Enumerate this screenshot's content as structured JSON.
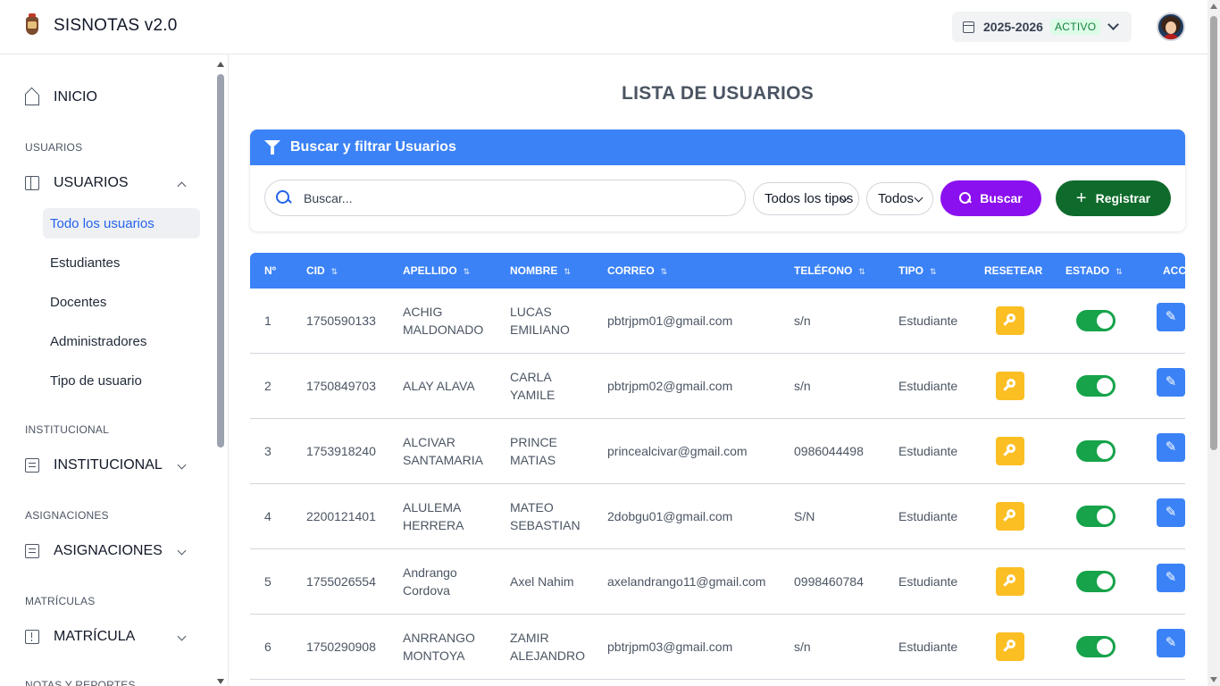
{
  "header": {
    "brand": "SISNOTAS v2.0",
    "period_year": "2025-2026",
    "period_status": "ACTIVO"
  },
  "sidebar": {
    "inicio": "INICIO",
    "sec_usuarios": "USUARIOS",
    "usuarios": "USUARIOS",
    "sub": [
      "Todo los usuarios",
      "Estudiantes",
      "Docentes",
      "Administradores",
      "Tipo de usuario"
    ],
    "sec_institucional": "INSTITUCIONAL",
    "institucional": "INSTITUCIONAL",
    "sec_asignaciones": "ASIGNACIONES",
    "asignaciones": "ASIGNACIONES",
    "sec_matriculas": "MATRÍCULAS",
    "matricula": "MATRÍCULA",
    "sec_notas": "NOTAS Y REPORTES"
  },
  "main": {
    "title": "LISTA DE USUARIOS",
    "filter_title": "Buscar y filtrar Usuarios",
    "search_placeholder": "Buscar...",
    "type_select": "Todos los tipos",
    "state_select": "Todos",
    "search_button": "Buscar",
    "register_button": "Registrar"
  },
  "table": {
    "columns": [
      "Nº",
      "CID",
      "APELLIDO",
      "NOMBRE",
      "CORREO",
      "TELÉFONO",
      "TIPO",
      "RESETEAR",
      "ESTADO",
      "ACCI"
    ],
    "sort_glyph": "⇅",
    "edit_glyph": "✎",
    "rows": [
      {
        "n": "1",
        "cid": "1750590133",
        "ap1": "ACHIG",
        "ap2": "MALDONADO",
        "no1": "LUCAS",
        "no2": "EMILIANO",
        "correo": "pbtrjpm01@gmail.com",
        "tel": "s/n",
        "tipo": "Estudiante"
      },
      {
        "n": "2",
        "cid": "1750849703",
        "ap1": "ALAY ALAVA",
        "ap2": "",
        "no1": "CARLA",
        "no2": "YAMILE",
        "correo": "pbtrjpm02@gmail.com",
        "tel": "s/n",
        "tipo": "Estudiante"
      },
      {
        "n": "3",
        "cid": "1753918240",
        "ap1": "ALCIVAR",
        "ap2": "SANTAMARIA",
        "no1": "PRINCE",
        "no2": "MATIAS",
        "correo": "princealcivar@gmail.com",
        "tel": "0986044498",
        "tipo": "Estudiante"
      },
      {
        "n": "4",
        "cid": "2200121401",
        "ap1": "ALULEMA",
        "ap2": "HERRERA",
        "no1": "MATEO",
        "no2": "SEBASTIAN",
        "correo": "2dobgu01@gmail.com",
        "tel": "S/N",
        "tipo": "Estudiante"
      },
      {
        "n": "5",
        "cid": "1755026554",
        "ap1": "Andrango",
        "ap2": "Cordova",
        "no1": "Axel Nahim",
        "no2": "",
        "correo": "axelandrango11@gmail.com",
        "tel": "0998460784",
        "tipo": "Estudiante"
      },
      {
        "n": "6",
        "cid": "1750290908",
        "ap1": "ANRRANGO",
        "ap2": "MONTOYA",
        "no1": "ZAMIR",
        "no2": "ALEJANDRO",
        "correo": "pbtrjpm03@gmail.com",
        "tel": "s/n",
        "tipo": "Estudiante"
      }
    ]
  }
}
